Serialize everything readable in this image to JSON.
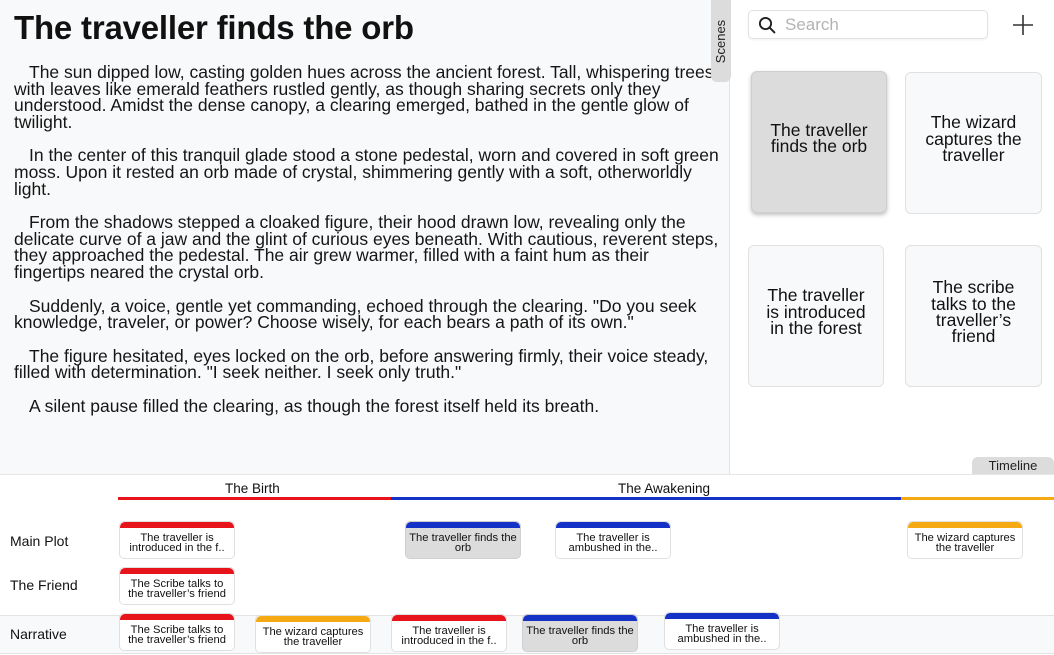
{
  "editor": {
    "title": "The traveller finds the orb",
    "paragraphs": [
      "The sun dipped low, casting golden hues across the ancient forest. Tall, whispering trees with leaves like emerald feathers rustled gently, as though sharing secrets only they understood. Amidst the dense canopy, a clearing emerged, bathed in the gentle glow of twilight.",
      "In the center of this tranquil glade stood a stone pedestal, worn and covered in soft green moss. Upon it rested an orb made of crystal, shimmering gently with a soft, otherworldly light.",
      "From the shadows stepped a cloaked figure, their hood drawn low, revealing only the delicate curve of a jaw and the glint of curious eyes beneath. With cautious, reverent steps, they approached the pedestal. The air grew warmer, filled with a faint hum as their fingertips neared the crystal orb.",
      "Suddenly, a voice, gentle yet commanding, echoed through the clearing. \"Do you seek knowledge, traveler, or power? Choose wisely, for each bears a path of its own.\"",
      "The figure hesitated, eyes locked on the orb, before answering firmly, their voice steady, filled with determination. \"I seek neither. I seek only truth.\"",
      "A silent pause filled the clearing, as though the forest itself held its breath."
    ],
    "scenes_tab_label": "Scenes"
  },
  "scenes_panel": {
    "search_placeholder": "Search",
    "add_icon": "plus-icon",
    "search_icon": "magnifier-icon",
    "cards": [
      {
        "label": "The traveller finds the orb",
        "selected": true
      },
      {
        "label": "The wizard captures the traveller",
        "selected": false
      },
      {
        "label": "The traveller is introduced in the forest",
        "selected": false
      },
      {
        "label": "The scribe talks to the traveller’s friend",
        "selected": false
      }
    ],
    "timeline_tab_label": "Timeline"
  },
  "timeline": {
    "arcs": [
      {
        "label": "The Birth",
        "color": "#e8141c"
      },
      {
        "label": "The Awakening",
        "color": "#1532c7"
      },
      {
        "label": "",
        "color": "#f5a913"
      }
    ],
    "tracks": [
      "Main Plot",
      "The Friend",
      "Narrative"
    ],
    "colors": {
      "red": "#e8141c",
      "blue": "#1532c7",
      "orange": "#f5a913",
      "selected_bg": "#dcdcdc",
      "panel_bg": "#f8f9fa"
    },
    "cards": [
      {
        "text": "The traveller is introduced in the f..",
        "color": "#e8141c",
        "selected": false
      },
      {
        "text": "The traveller finds the orb",
        "color": "#1532c7",
        "selected": true
      },
      {
        "text": "The traveller is ambushed in the..",
        "color": "#1532c7",
        "selected": false
      },
      {
        "text": "The wizard captures the traveller",
        "color": "#f5a913",
        "selected": false
      },
      {
        "text": "The Scribe talks to the traveller’s friend",
        "color": "#e8141c",
        "selected": false
      },
      {
        "text": "The Scribe talks to the traveller’s friend",
        "color": "#e8141c",
        "selected": false
      },
      {
        "text": "The wizard captures the traveller",
        "color": "#f5a913",
        "selected": false
      },
      {
        "text": "The traveller is introduced in the f..",
        "color": "#e8141c",
        "selected": false
      },
      {
        "text": "The traveller finds the orb",
        "color": "#1532c7",
        "selected": true
      },
      {
        "text": "The traveller is ambushed in the..",
        "color": "#1532c7",
        "selected": false
      }
    ]
  }
}
